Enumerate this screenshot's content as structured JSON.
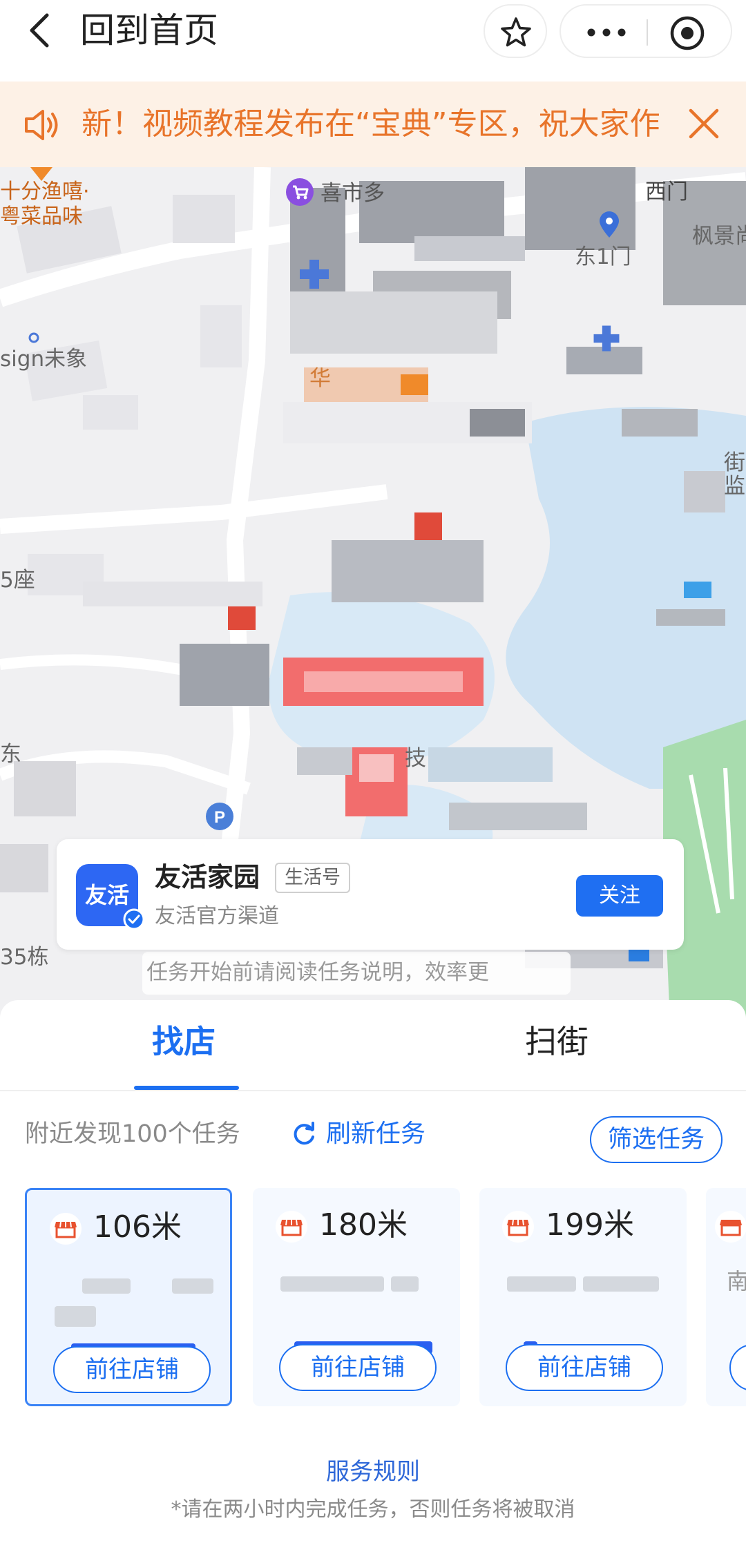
{
  "navbar": {
    "title": "回到首页"
  },
  "notice": {
    "text": "新！视频教程发布在“宝典”专区，祝大家作"
  },
  "map": {
    "labels": {
      "restaurant": "十分渔嘻·",
      "restaurant_sub": "粤菜品味",
      "supermarket": "喜市多",
      "west_gate": "西门",
      "maple": "枫景尚",
      "east_gate": "东1门",
      "design": "sign未象",
      "street": "街",
      "supervise": "监",
      "building_seat": "5座",
      "building_35": "35栋",
      "hua": "华",
      "ji": "技",
      "east_char": "东"
    },
    "colors": {
      "land": "#f0f0f2",
      "water": "#cfe3f3",
      "green": "#a8dcae",
      "highlight": "#f26d6d"
    }
  },
  "account": {
    "avatar_text": "友活",
    "name": "友活家园",
    "tag": "生活号",
    "subtitle": "友活官方渠道",
    "follow_label": "关注"
  },
  "task_hint": "任务开始前请阅读任务说明，效率更",
  "tabs": [
    {
      "label": "找店",
      "active": true
    },
    {
      "label": "扫街",
      "active": false
    }
  ],
  "tasks": {
    "nearby_label": "附近发现100个任务",
    "refresh_label": "刷新任务",
    "filter_label": "筛选任务"
  },
  "cards": [
    {
      "distance": "106米",
      "button_label": "前往店铺",
      "selected": true
    },
    {
      "distance": "180米",
      "button_label": "前往店铺",
      "selected": false
    },
    {
      "distance": "199米",
      "button_label": "前往店铺",
      "selected": false
    },
    {
      "peek_text": "南"
    }
  ],
  "footer": {
    "rules_label": "服务规则",
    "note": "*请在两小时内完成任务，否则任务将被取消"
  }
}
